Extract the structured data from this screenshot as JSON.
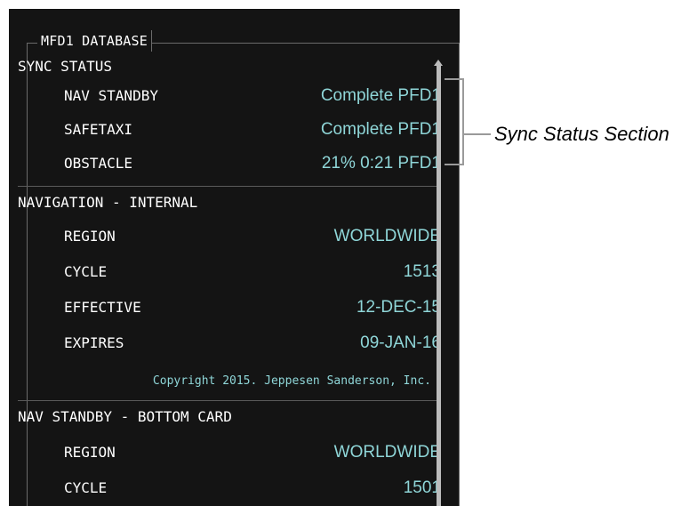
{
  "database_box": {
    "title": "MFD1 DATABASE"
  },
  "sync_status": {
    "header": "SYNC STATUS",
    "rows": [
      {
        "label": "NAV STANDBY",
        "value": "Complete PFD1"
      },
      {
        "label": "SAFETAXI",
        "value": "Complete PFD1"
      },
      {
        "label": "OBSTACLE",
        "value": "21% 0:21 PFD1"
      }
    ]
  },
  "navigation_internal": {
    "header": "NAVIGATION - INTERNAL",
    "rows": [
      {
        "label": "REGION",
        "value": "WORLDWIDE"
      },
      {
        "label": "CYCLE",
        "value": "1513"
      },
      {
        "label": "EFFECTIVE",
        "value": "12-DEC-15"
      },
      {
        "label": "EXPIRES",
        "value": "09-JAN-16"
      }
    ],
    "copyright": "Copyright 2015. Jeppesen Sanderson, Inc."
  },
  "nav_standby_bottom_card": {
    "header": "NAV STANDBY - BOTTOM CARD",
    "rows": [
      {
        "label": "REGION",
        "value": "WORLDWIDE"
      },
      {
        "label": "CYCLE",
        "value": "1501"
      }
    ]
  },
  "callout": {
    "text": "Sync Status Section"
  },
  "colors": {
    "panel_bg": "#141414",
    "label": "#ffffff",
    "value": "#8fd6d8",
    "divider": "#5a5a5a"
  }
}
